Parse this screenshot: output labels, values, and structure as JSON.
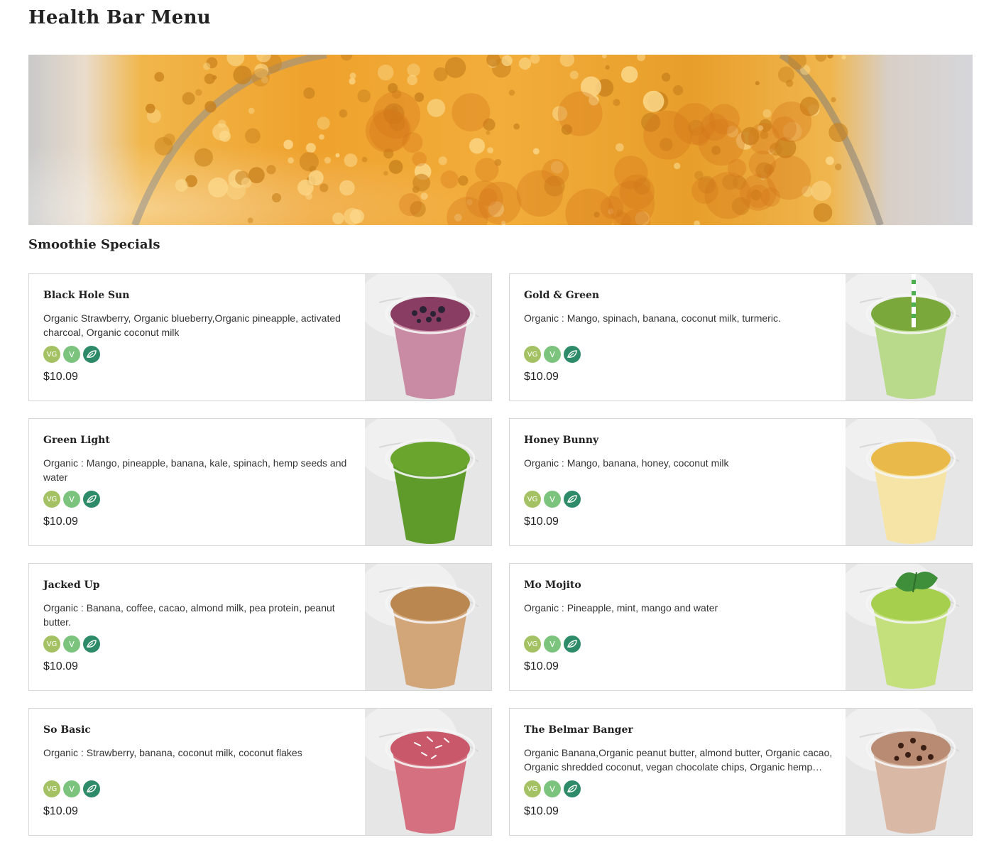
{
  "page": {
    "title": "Health Bar Menu"
  },
  "section": {
    "title": "Smoothie Specials"
  },
  "colors": {
    "vegan_badge": "#a4c263",
    "vegetarian_badge": "#7cc47e",
    "plant_badge": "#2e8b6a",
    "border": "#d6d6d6"
  },
  "badges": [
    {
      "label": "VG",
      "icon": "vegan-icon"
    },
    {
      "label": "V",
      "icon": "vegetarian-icon"
    },
    {
      "label": "",
      "icon": "leaf-icon"
    }
  ],
  "items": [
    {
      "name": "Black Hole Sun",
      "description": "Organic Strawberry, Organic blueberry,Organic pineapple, activated charcoal, Organic coconut milk",
      "price": "$10.09",
      "smoothie_color": "#c98aa3",
      "top_color": "#8a3d62"
    },
    {
      "name": "Gold & Green",
      "description": "Organic : Mango, spinach, banana, coconut milk, turmeric.",
      "price": "$10.09",
      "smoothie_color": "#b9d98b",
      "top_color": "#7aa83a"
    },
    {
      "name": "Green Light",
      "description": "Organic : Mango, pineapple, banana, kale, spinach, hemp seeds and water",
      "price": "$10.09",
      "smoothie_color": "#5f9b2a",
      "top_color": "#6aa62e"
    },
    {
      "name": "Honey Bunny",
      "description": "Organic : Mango, banana, honey, coconut milk",
      "price": "$10.09",
      "smoothie_color": "#f5e4a6",
      "top_color": "#e9b94a"
    },
    {
      "name": "Jacked Up",
      "description": "Organic : Banana, coffee, cacao, almond milk, pea protein, peanut butter.",
      "price": "$10.09",
      "smoothie_color": "#d2a679",
      "top_color": "#b9874f"
    },
    {
      "name": "Mo Mojito",
      "description": "Organic : Pineapple, mint, mango and water",
      "price": "$10.09",
      "smoothie_color": "#c4e07d",
      "top_color": "#a6cf4e"
    },
    {
      "name": "So Basic",
      "description": "Organic : Strawberry, banana, coconut milk, coconut flakes",
      "price": "$10.09",
      "smoothie_color": "#d4707f",
      "top_color": "#c9586a"
    },
    {
      "name": "The Belmar Banger",
      "description": "Organic Banana,Organic peanut butter, almond butter, Organic cacao, Organic shredded coconut, vegan chocolate chips, Organic hemp seeds",
      "price": "$10.09",
      "smoothie_color": "#d9b8a6",
      "top_color": "#b98b72"
    }
  ]
}
